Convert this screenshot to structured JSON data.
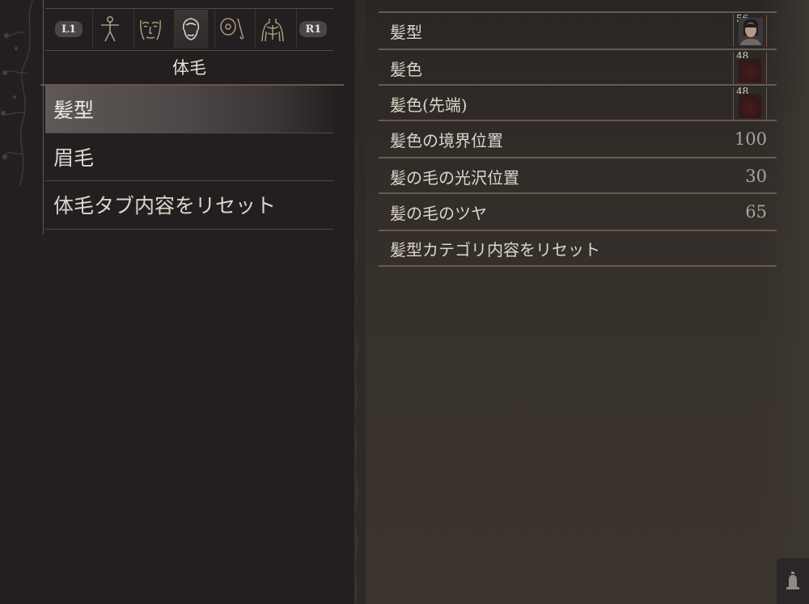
{
  "left_panel": {
    "tabs": {
      "left_button": "L1",
      "right_button": "R1",
      "icons": [
        "body-figure-icon",
        "face-icon",
        "hair-icon",
        "eye-brush-icon",
        "torso-icon"
      ],
      "selected_index": 2
    },
    "category_title": "体毛",
    "menu": [
      {
        "label": "髪型",
        "active": true
      },
      {
        "label": "眉毛",
        "active": false
      },
      {
        "label": "体毛タブ内容をリセット",
        "active": false
      }
    ]
  },
  "right_panel": {
    "rows": [
      {
        "label": "髪型",
        "value": "",
        "thumb_number": "56",
        "thumb_type": "portrait"
      },
      {
        "label": "髪色",
        "value": "",
        "thumb_number": "48",
        "thumb_type": "color-swatch"
      },
      {
        "label": "髪色(先端)",
        "value": "",
        "thumb_number": "48",
        "thumb_type": "color-swatch"
      },
      {
        "label": "髪色の境界位置",
        "value": "100"
      },
      {
        "label": "髪の毛の光沢位置",
        "value": "30"
      },
      {
        "label": "髪の毛のツヤ",
        "value": "65"
      },
      {
        "label": "髪型カテゴリ内容をリセット",
        "value": ""
      }
    ]
  },
  "colors": {
    "left_bg": "#231f20",
    "right_bg": "#332e29",
    "accent_line": "#6a5b4d",
    "hair_color_swatch": "#4a1c1c"
  },
  "corner": {
    "icon": "bell-icon"
  }
}
